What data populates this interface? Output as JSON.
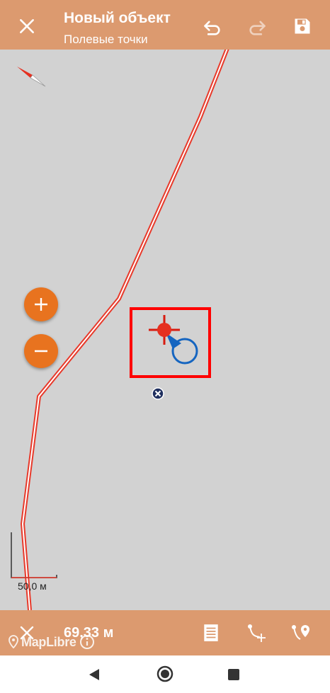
{
  "header": {
    "title": "Новый объект",
    "subtitle": "Полевые точки",
    "close_icon": "close-icon",
    "undo_icon": "undo-icon",
    "redo_icon": "redo-icon",
    "save_icon": "save-icon"
  },
  "map": {
    "background_color": "#d2d2d2",
    "line_color": "#e8392a",
    "selection_color": "#ff0000",
    "compass_icon": "compass-icon",
    "zoom_in_icon": "plus-icon",
    "zoom_out_icon": "minus-icon",
    "scale_label": "50,0 м",
    "attribution": "MapLibre",
    "info_icon": "info-icon",
    "marker_icon": "location-marker-icon",
    "gps_icon": "gps-position-icon",
    "crosshair_icon": "crosshair-icon"
  },
  "footer": {
    "distance": "69,33 м",
    "close_icon": "close-icon",
    "list_icon": "list-icon",
    "add_line_point_icon": "add-line-point-icon",
    "add_marker_icon": "add-marker-icon"
  },
  "navigation": {
    "back_icon": "back-icon",
    "home_icon": "home-icon",
    "recents_icon": "recents-icon"
  },
  "colors": {
    "bar": "#dc9a6f",
    "accent": "#e8731f",
    "blue": "#1565c0"
  }
}
